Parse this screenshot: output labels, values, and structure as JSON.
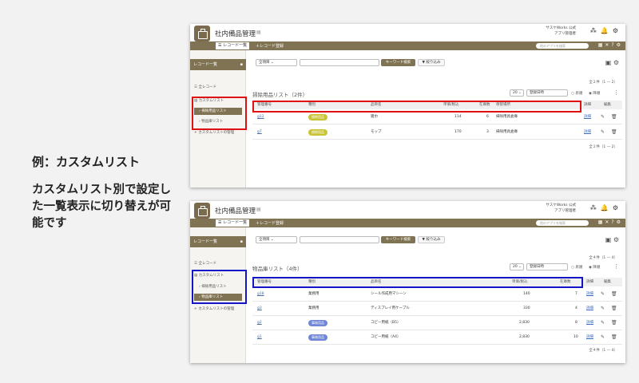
{
  "caption": {
    "title": "例：カスタムリスト",
    "body": "カスタムリスト別で設定した一覧表示に切り替えが可能です"
  },
  "app": {
    "title": "社内備品管理",
    "title_icon": "▤",
    "user_org": "サスケWorks 公式",
    "user_name": "アプリ管理者",
    "nav_list_tab": "☰ レコード一覧",
    "nav_register": "＋レコード登録",
    "search_placeholder": "他のアプリを検索",
    "icons": [
      "grid-icon",
      "bell-icon",
      "gear-icon",
      "apps-icon",
      "tools-icon",
      "help-icon",
      "settings-icon"
    ]
  },
  "sidebar": {
    "header": "レコード一覧",
    "pin_icon": "📌",
    "all_records": "全レコード",
    "custom_list": "カスタムリスト",
    "list1": "掃除用品リスト",
    "list2": "物品庫リスト",
    "manage": "カスタムリストの管理"
  },
  "toolbar": {
    "field_select": "全項目",
    "keyword_button": "キーワード検索",
    "filter_button": "▼ 絞り込み"
  },
  "panels": [
    {
      "count_top": "全２件（1 ― 2）",
      "count_bottom": "全２件（1 ― 2）",
      "list_title": "掃除用品リスト（2件）",
      "per_page": "20",
      "sort_field": "登録日時",
      "asc": "昇順",
      "desc": "降順",
      "columns": [
        "管理番号",
        "種別",
        "品目名",
        "単価/税込",
        "在庫数",
        "保管場所",
        "詳細",
        "編集"
      ],
      "rows": [
        {
          "id": "g12",
          "type": "掃除用品",
          "name": "雑巾",
          "price": "114",
          "stock": "6",
          "place": "掃除用具倉庫",
          "detail": "詳細"
        },
        {
          "id": "g7",
          "type": "掃除用品",
          "name": "モップ",
          "price": "170",
          "stock": "3",
          "place": "掃除用具倉庫",
          "detail": "詳細"
        }
      ]
    },
    {
      "count_top": "全４件（1 ― 4）",
      "count_bottom": "全４件（1 ― 4）",
      "list_title": "物品庫リスト（4件）",
      "per_page": "20",
      "sort_field": "登録日時",
      "asc": "昇順",
      "desc": "降順",
      "columns": [
        "管理番号",
        "種別",
        "品目名",
        "単価/税込",
        "在庫数",
        "詳細",
        "編集"
      ],
      "rows": [
        {
          "id": "g18",
          "type": "業務用",
          "badge": false,
          "name": "シール作成用マシーン",
          "price": "140",
          "stock": "7",
          "detail": "詳細"
        },
        {
          "id": "g3",
          "type": "業務用",
          "badge": false,
          "name": "ディスプレイ用ケーブル",
          "price": "330",
          "stock": "4",
          "detail": "詳細"
        },
        {
          "id": "g2",
          "type": "事務用品",
          "badge": true,
          "name": "コピー用紙（B5）",
          "price": "2,830",
          "stock": "8",
          "detail": "詳細"
        },
        {
          "id": "g1",
          "type": "事務用品",
          "badge": true,
          "name": "コピー用紙（A4）",
          "price": "2,830",
          "stock": "10",
          "detail": "詳細"
        }
      ]
    }
  ]
}
